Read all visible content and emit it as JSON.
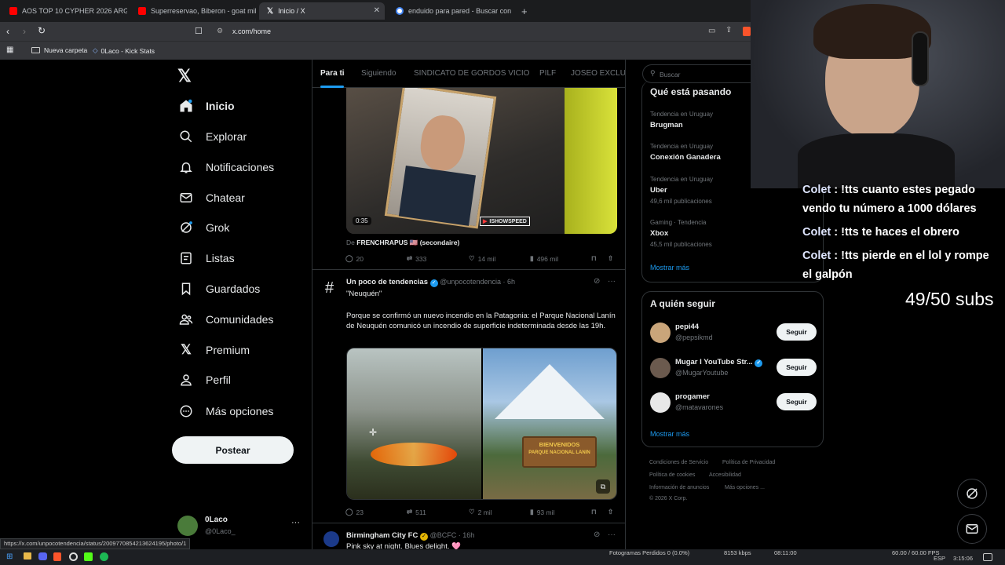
{
  "browser": {
    "tabs": [
      {
        "title": "AOS TOP 10 CYPHER 2026 ARG - You",
        "favicon_color": "#ff0000"
      },
      {
        "title": "Superreservao, Biberon - goat milk",
        "favicon_color": "#ff0000"
      },
      {
        "title": "Inicio / X",
        "favicon_color": "#ffffff"
      },
      {
        "title": "enduido para pared - Buscar con Go",
        "favicon_color": "#4285f4"
      }
    ],
    "new_tab": "+",
    "url": "x.com/home",
    "bookmarks": [
      "Nueva carpeta",
      "0Laco - Kick Stats"
    ],
    "status_url": "https://x.com/unpocotendencia/status/2009770854213624195/photo/1"
  },
  "x": {
    "nav": [
      {
        "label": "Inicio",
        "icon": "home-icon"
      },
      {
        "label": "Explorar",
        "icon": "search-icon"
      },
      {
        "label": "Notificaciones",
        "icon": "bell-icon"
      },
      {
        "label": "Chatear",
        "icon": "mail-icon"
      },
      {
        "label": "Grok",
        "icon": "grok-icon"
      },
      {
        "label": "Listas",
        "icon": "list-icon"
      },
      {
        "label": "Guardados",
        "icon": "bookmark-icon"
      },
      {
        "label": "Comunidades",
        "icon": "communities-icon"
      },
      {
        "label": "Premium",
        "icon": "x-logo-icon"
      },
      {
        "label": "Perfil",
        "icon": "profile-icon"
      },
      {
        "label": "Más opciones",
        "icon": "more-circle-icon"
      }
    ],
    "post_button": "Postear",
    "account": {
      "name": "0Laco",
      "handle": "@0Laco_"
    },
    "feed_tabs": [
      "Para ti",
      "Siguiendo",
      "SINDICATO DE GORDOS VICIO",
      "PILF",
      "JOSEO EXCLUSI"
    ],
    "post1": {
      "video_time": "0:35",
      "watermark": "ISHOWSPEED",
      "source_prefix": "De",
      "source": "FRENCHRAPUS 🇺🇸 (secondaire)",
      "replies": "20",
      "reposts": "333",
      "likes": "14 mil",
      "views": "496 mil"
    },
    "post2": {
      "author": "Un poco de tendencias",
      "handle": "@unpocotendencia · 6h",
      "title": "\"Neuquén\"",
      "body": "Porque se confirmó un nuevo incendio en la Patagonia: el Parque Nacional Lanín de Neuquén comunicó un incendio de superficie indeterminada desde las 19h.",
      "sign_line1": "BIENVENIDOS",
      "sign_line2": "PARQUE NACIONAL LANIN",
      "replies": "23",
      "reposts": "511",
      "likes": "2 mil",
      "views": "93 mil"
    },
    "post3": {
      "author": "Birmingham City FC",
      "handle": "@BCFC · 16h",
      "body": "Pink sky at night. Blues delight. 🩷"
    },
    "search_placeholder": "Buscar",
    "trends_title": "Qué está pasando",
    "trends": [
      {
        "category": "Tendencia en Uruguay",
        "name": "Brugman",
        "count": ""
      },
      {
        "category": "Tendencia en Uruguay",
        "name": "Conexión Ganadera",
        "count": ""
      },
      {
        "category": "Tendencia en Uruguay",
        "name": "Uber",
        "count": "49,6 mil publicaciones"
      },
      {
        "category": "Gaming · Tendencia",
        "name": "Xbox",
        "count": "45,5 mil publicaciones"
      }
    ],
    "show_more": "Mostrar más",
    "follow_title": "A quién seguir",
    "follow": [
      {
        "name": "pepi44",
        "handle": "@pepsikmd",
        "button": "Seguir"
      },
      {
        "name": "Mugar I YouTube Str...",
        "handle": "@MugarYoutube",
        "button": "Seguir"
      },
      {
        "name": "progamer",
        "handle": "@matavarones",
        "button": "Seguir"
      }
    ],
    "footer": {
      "l1a": "Condiciones de Servicio",
      "l1b": "Política de Privacidad",
      "l2a": "Política de cookies",
      "l2b": "Accesibilidad",
      "l3a": "Información de anuncios",
      "l3b": "Más opciones ...",
      "copy": "© 2026 X Corp."
    }
  },
  "stream": {
    "chat": [
      {
        "user": "Colet",
        "text": ": !tts cuanto estes pegado"
      },
      {
        "user": "",
        "text": "vendo tu número a 1000 dólares"
      },
      {
        "user": "Colet",
        "text": ": !tts te haces el obrero"
      },
      {
        "user": "Colet",
        "text": ": !tts pierde en el lol y rompe"
      },
      {
        "user": "",
        "text": "el galpón"
      }
    ],
    "subs": "49/50 subs"
  },
  "taskbar": {
    "obs_stats": "Fotogramas Perdidos 0 (0.0%)",
    "bitrate": "8153 kbps",
    "rec_time": "08:11:00",
    "fps": "60.00 / 60.00 FPS",
    "lang": "ESP",
    "clock": "3:15:06"
  }
}
